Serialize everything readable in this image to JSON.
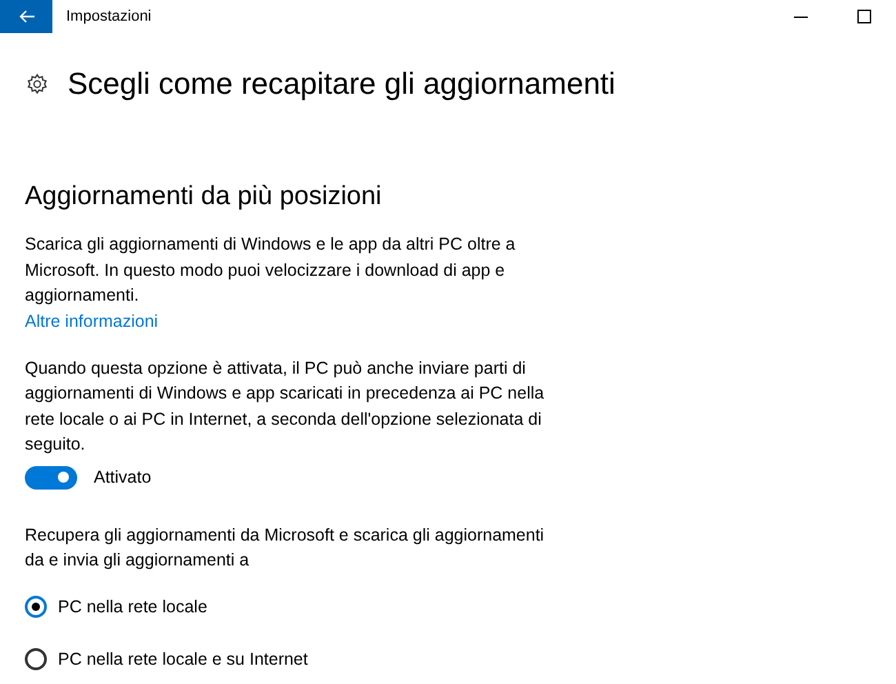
{
  "window": {
    "title": "Impostazioni"
  },
  "page": {
    "title": "Scegli come recapitare gli aggiornamenti"
  },
  "section": {
    "title": "Aggiornamenti da più posizioni",
    "description": "Scarica gli aggiornamenti di Windows e le app da altri PC oltre a Microsoft. In questo modo puoi velocizzare i download di app e aggiornamenti.",
    "link": "Altre informazioni",
    "toggle_description": "Quando questa opzione è attivata, il PC può anche inviare parti di aggiornamenti di Windows e app scaricati in precedenza ai PC nella rete locale o ai PC in Internet, a seconda dell'opzione selezionata di seguito.",
    "toggle": {
      "on": true,
      "label": "Attivato"
    },
    "options_description": "Recupera gli aggiornamenti da Microsoft e scarica gli aggiornamenti da e invia gli aggiornamenti a",
    "options": [
      {
        "label": "PC nella rete locale",
        "selected": true
      },
      {
        "label": "PC nella rete locale e su Internet",
        "selected": false
      }
    ]
  }
}
